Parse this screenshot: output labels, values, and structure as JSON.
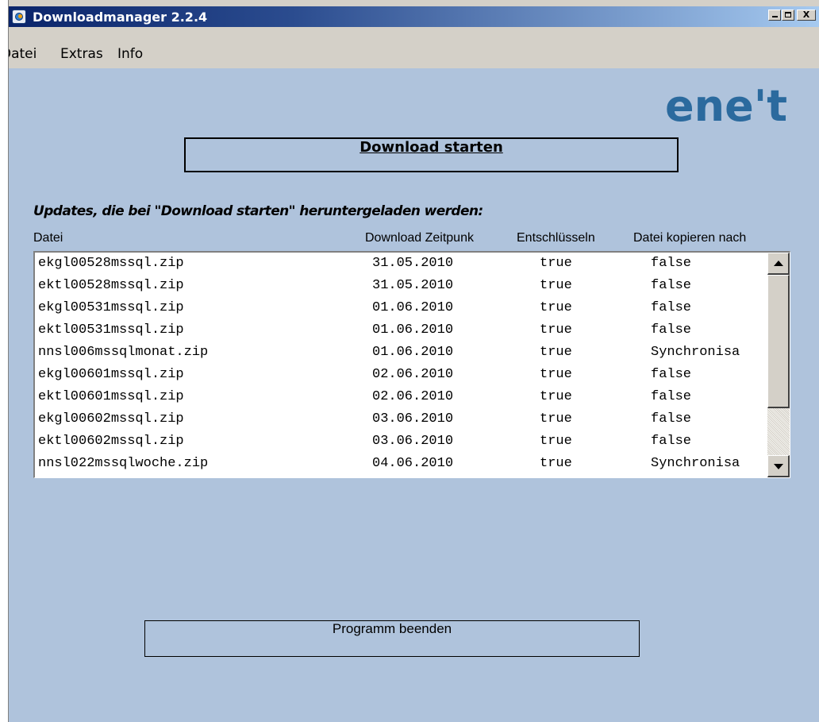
{
  "window": {
    "title": "Downloadmanager 2.2.4",
    "app_icon": "downloadmanager-icon",
    "controls": {
      "minimize": "_",
      "maximize": "□",
      "close": "X"
    }
  },
  "menu": {
    "items": [
      {
        "label": "Datei"
      },
      {
        "label": "Extras"
      },
      {
        "label": "Info"
      }
    ]
  },
  "logo": {
    "text": "ene't",
    "color": "#2b6a9e"
  },
  "actions": {
    "download_label": "Download starten",
    "exit_label": "Programm beenden"
  },
  "updates": {
    "heading": "Updates, die bei \"Download starten\" heruntergeladen werden:",
    "columns": [
      "Datei",
      "Download Zeitpunk",
      "Entschlüsseln",
      "Datei kopieren nach"
    ],
    "rows": [
      [
        "ekgl00528mssql.zip",
        "31.05.2010",
        "true",
        "false"
      ],
      [
        "ektl00528mssql.zip",
        "31.05.2010",
        "true",
        "false"
      ],
      [
        "ekgl00531mssql.zip",
        "01.06.2010",
        "true",
        "false"
      ],
      [
        "ektl00531mssql.zip",
        "01.06.2010",
        "true",
        "false"
      ],
      [
        "nnsl006mssqlmonat.zip",
        "01.06.2010",
        "true",
        "Synchronisa"
      ],
      [
        "ekgl00601mssql.zip",
        "02.06.2010",
        "true",
        "false"
      ],
      [
        "ektl00601mssql.zip",
        "02.06.2010",
        "true",
        "false"
      ],
      [
        "ekgl00602mssql.zip",
        "03.06.2010",
        "true",
        "false"
      ],
      [
        "ektl00602mssql.zip",
        "03.06.2010",
        "true",
        "false"
      ],
      [
        "nnsl022mssqlwoche.zip",
        "04.06.2010",
        "true",
        "Synchronisa"
      ]
    ]
  },
  "colors": {
    "titlebar_start": "#0a246a",
    "titlebar_end": "#a6caf0",
    "client_background": "#afc3dc",
    "chrome": "#d4d0c8"
  }
}
